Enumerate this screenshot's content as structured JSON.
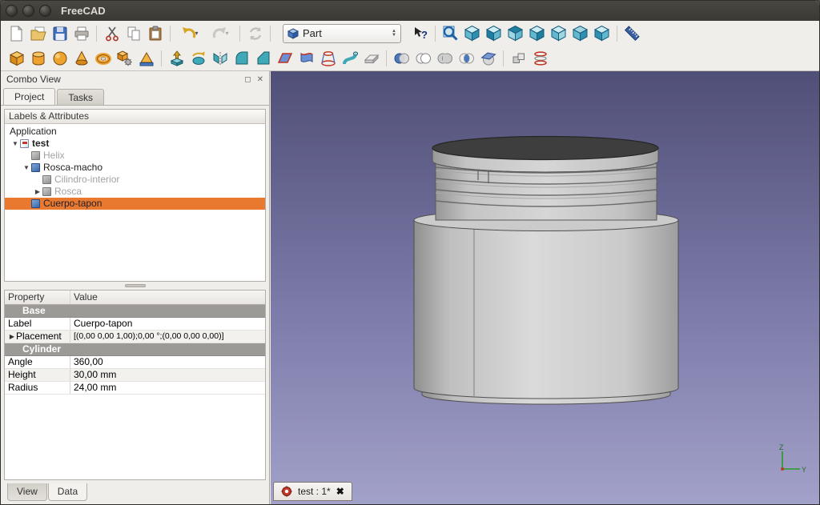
{
  "window": {
    "title": "FreeCAD"
  },
  "titlebar": {
    "buttons": [
      "close",
      "minimize",
      "maximize"
    ]
  },
  "toolbar_file": {
    "buttons": [
      "new-document",
      "open-document",
      "save",
      "print",
      "cut",
      "copy",
      "paste",
      "undo",
      "redo",
      "refresh"
    ],
    "workbench_selector": {
      "value": "Part"
    },
    "buttons_right": [
      "whats-this",
      "fit-all",
      "axonometric-view",
      "front-view",
      "top-view",
      "right-view",
      "rear-view",
      "bottom-view",
      "left-view",
      "measure-distance"
    ]
  },
  "toolbar_part": {
    "buttons": [
      "box",
      "cylinder",
      "sphere",
      "cone",
      "torus",
      "create-primitives",
      "shape-builder",
      "extrude",
      "revolve",
      "mirror",
      "fillet",
      "chamfer",
      "make-face-from-sketch",
      "ruled-surface",
      "loft",
      "sweep",
      "offset",
      "boolean",
      "cut",
      "union",
      "intersection",
      "section",
      "compound",
      "cross-sections"
    ]
  },
  "combo_view": {
    "title": "Combo View",
    "tabs": {
      "project": "Project",
      "tasks": "Tasks"
    },
    "tree_header": "Labels & Attributes",
    "tree": {
      "root": "Application",
      "items": [
        {
          "label": "test"
        },
        {
          "label": "Helix"
        },
        {
          "label": "Rosca-macho"
        },
        {
          "label": "Cilindro-interior"
        },
        {
          "label": "Rosca"
        },
        {
          "label": "Cuerpo-tapon"
        }
      ]
    },
    "property_editor": {
      "columns": {
        "property": "Property",
        "value": "Value"
      },
      "rows": [
        {
          "label": "Base",
          "value": ""
        },
        {
          "label": "Label",
          "value": "Cuerpo-tapon"
        },
        {
          "label": "Placement",
          "value": "[(0,00 0,00 1,00);0,00 °;(0,00 0,00 0,00)]"
        },
        {
          "label": "Cylinder",
          "value": ""
        },
        {
          "label": "Angle",
          "value": "360,00"
        },
        {
          "label": "Height",
          "value": "30,00 mm"
        },
        {
          "label": "Radius",
          "value": "24,00 mm"
        }
      ]
    },
    "bottom_tabs": {
      "view": "View",
      "data": "Data"
    }
  },
  "viewport": {
    "document_tab": "test : 1*",
    "axis": {
      "z": "Z",
      "y": "Y"
    },
    "colors": {
      "bg_top": "#504f77",
      "bg_bottom": "#a2a1c9",
      "selection": "#e9792e"
    }
  }
}
